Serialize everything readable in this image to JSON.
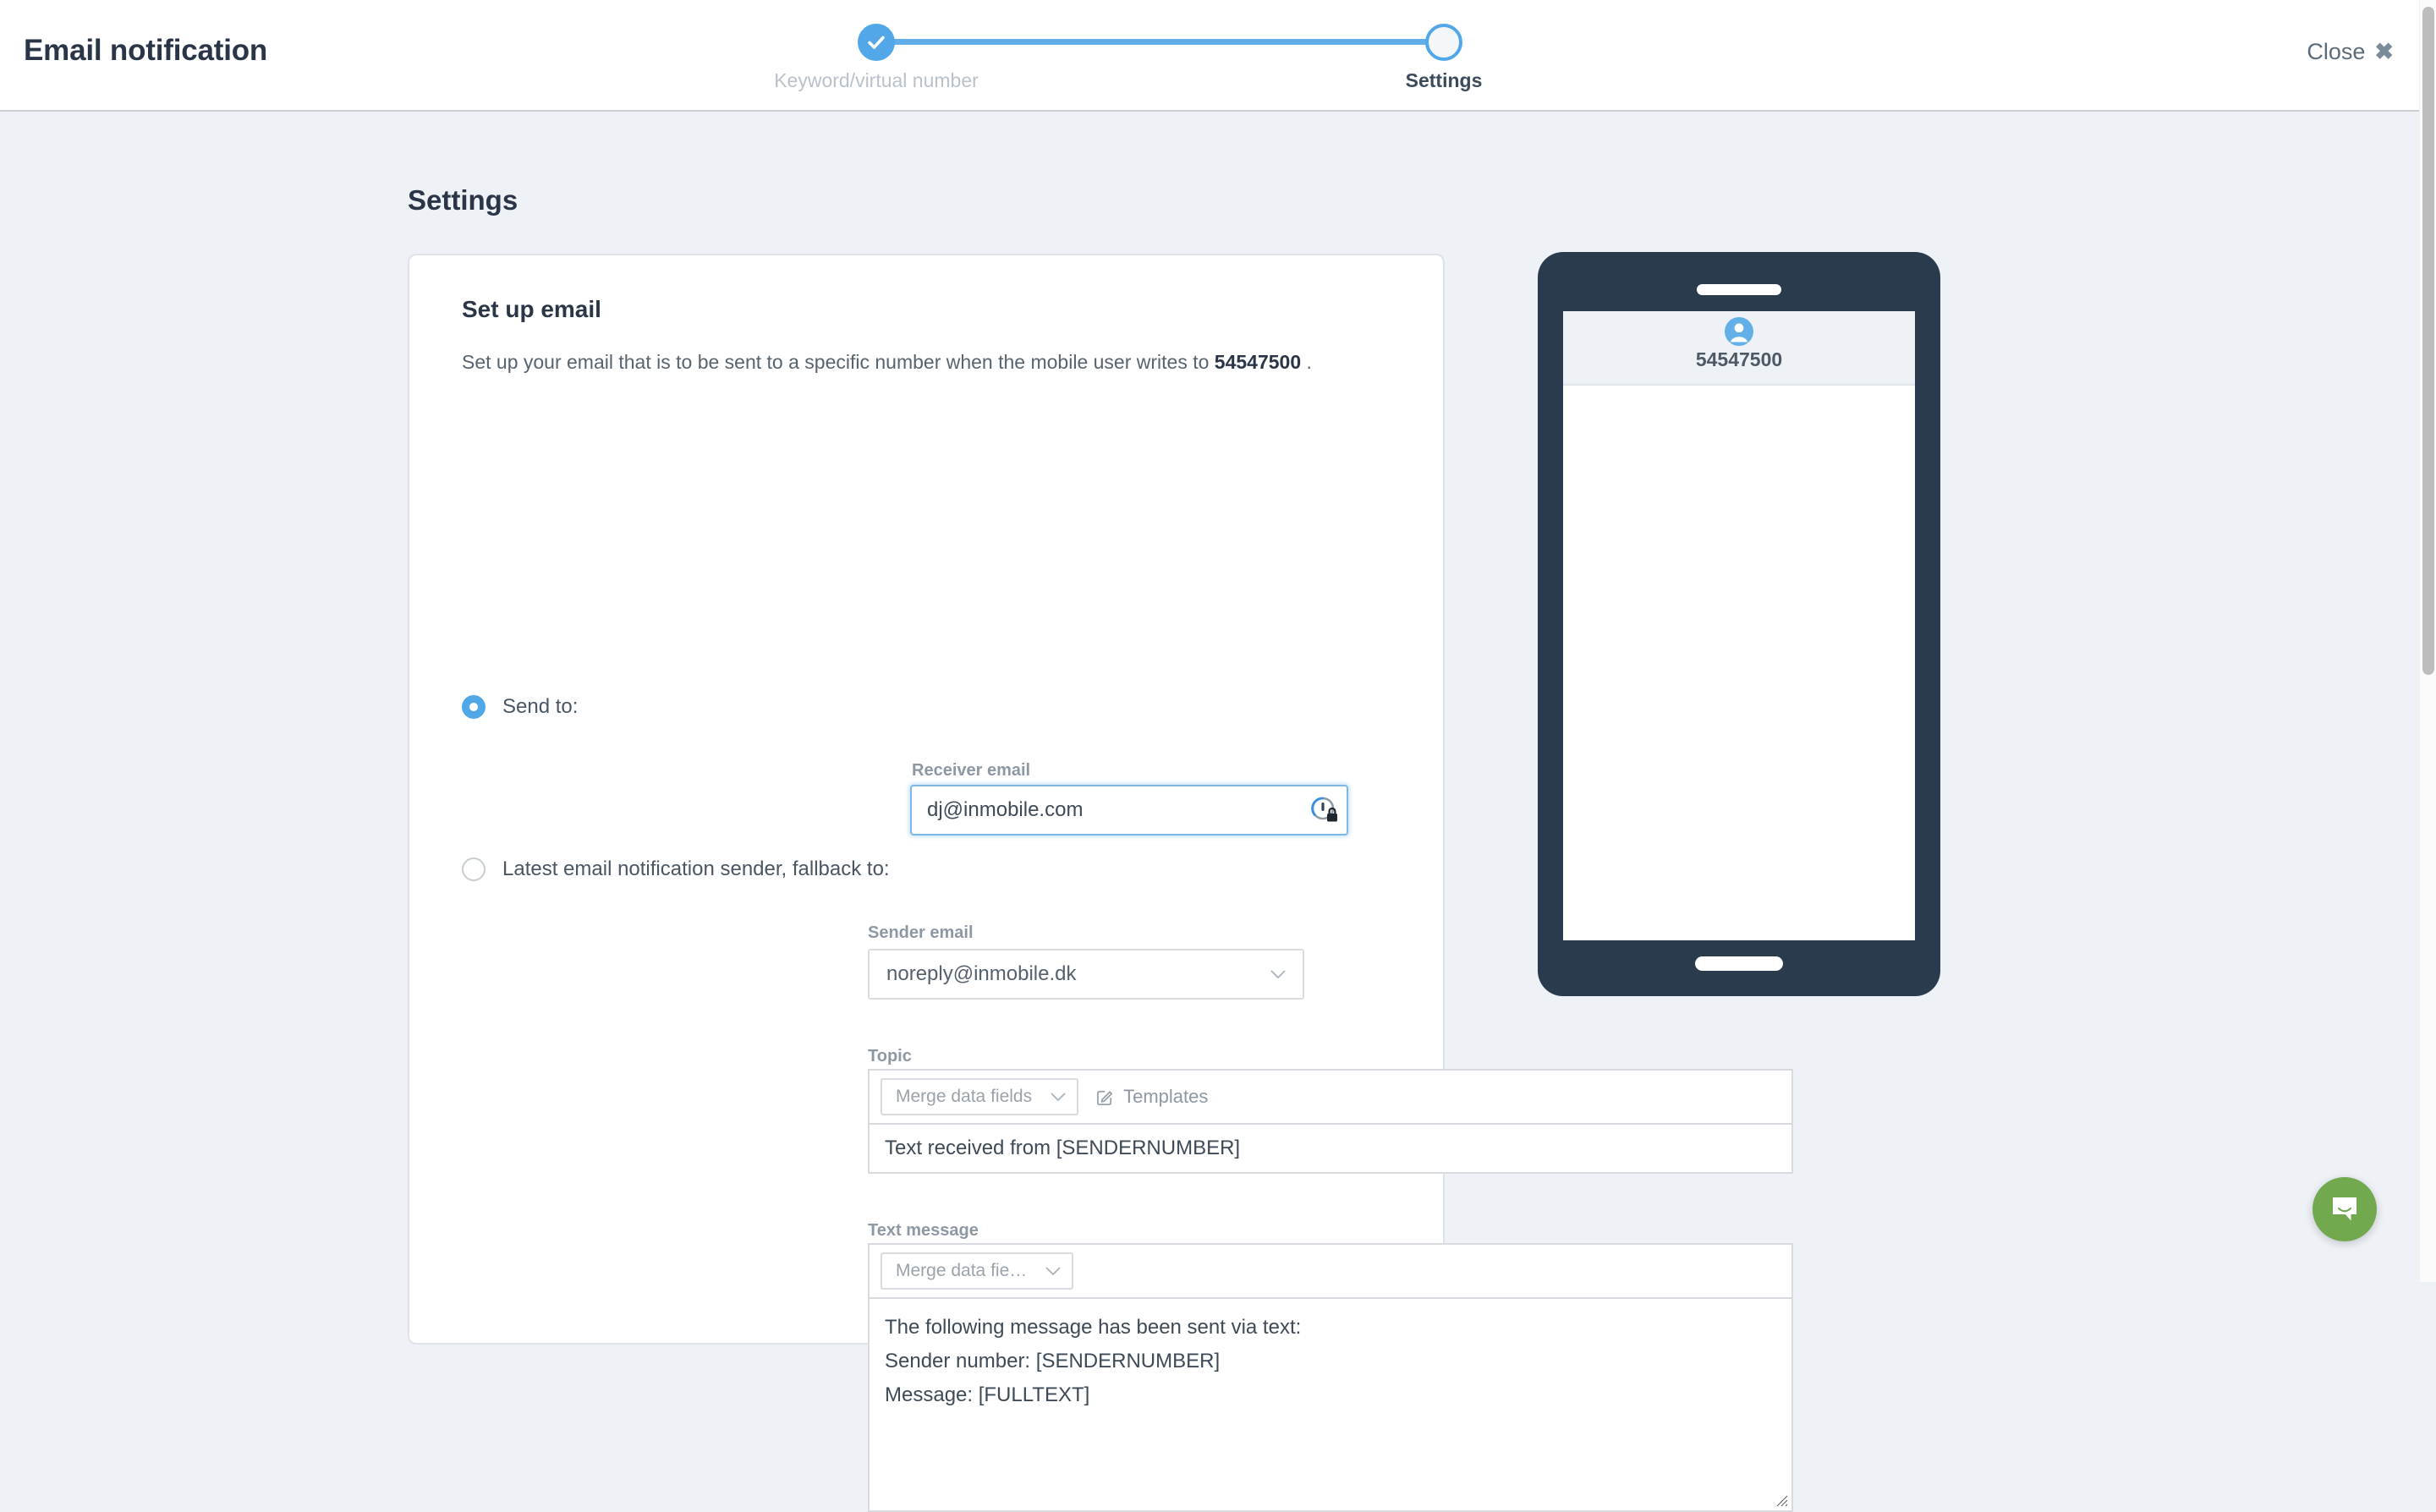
{
  "header": {
    "title": "Email notification",
    "close_label": "Close",
    "close_icon": "close-x-icon"
  },
  "stepper": {
    "steps": [
      {
        "label": "Keyword/virtual number",
        "state": "completed",
        "icon": "check-icon"
      },
      {
        "label": "Settings",
        "state": "current",
        "icon": ""
      }
    ],
    "accent_color": "#51a7e8",
    "inactive_label_color": "#b9c2cc"
  },
  "page": {
    "title": "Settings"
  },
  "card": {
    "title": "Set up email",
    "description_prefix": "Set up your email that is to be sent to a specific number when the mobile user writes to",
    "description_number": "54547500",
    "description_suffix": ".",
    "options": [
      {
        "label": "Send to:",
        "selected": true
      },
      {
        "label": "Latest email notification sender, fallback to:",
        "selected": false
      }
    ],
    "receiver": {
      "label": "Receiver email",
      "value": "dj@inmobile.com",
      "placeholder": "",
      "icon": "password-manager-lock-icon",
      "focused": true
    },
    "sender": {
      "label": "Sender email",
      "value": "noreply@inmobile.dk",
      "chevron_icon": "chevron-down-icon"
    },
    "topic": {
      "label": "Topic",
      "merge_label": "Merge data fields",
      "templates_label": "Templates",
      "templates_icon": "pencil-square-icon",
      "chevron_icon": "chevron-down-icon",
      "value": "Text received from [SENDERNUMBER]"
    },
    "message": {
      "label": "Text message",
      "merge_label": "Merge data fie…",
      "chevron_icon": "chevron-down-icon",
      "value": "The following message has been sent via text:\nSender number: [SENDERNUMBER]\nMessage: [FULLTEXT]"
    }
  },
  "phone_preview": {
    "number": "54547500",
    "avatar_icon": "user-avatar-icon",
    "body_text": ""
  },
  "chat_widget": {
    "icon": "chat-bubble-smile-icon",
    "color": "#72a94f"
  }
}
